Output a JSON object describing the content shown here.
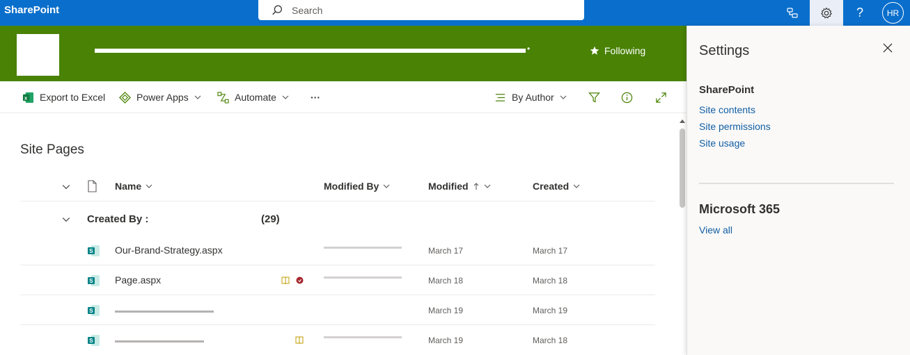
{
  "suite": {
    "brand": "SharePoint",
    "search_placeholder": "Search",
    "avatar_initials": "HR"
  },
  "site": {
    "follow_label": "Following"
  },
  "commandbar": {
    "export_label": "Export to Excel",
    "powerapps_label": "Power Apps",
    "automate_label": "Automate",
    "more_label": "···",
    "view_label": "By Author"
  },
  "list": {
    "title": "Site Pages",
    "columns": {
      "name": "Name",
      "modified_by": "Modified By",
      "modified": "Modified",
      "created": "Created"
    },
    "group": {
      "label": "Created By :",
      "count": "(29)"
    },
    "rows": [
      {
        "name": "Our-Brand-Strategy.aspx",
        "modified": "March 17",
        "created": "March 17"
      },
      {
        "name": "Page.aspx",
        "modified": "March 18",
        "created": "March 18"
      },
      {
        "name": "",
        "modified": "March 19",
        "created": "March 19"
      },
      {
        "name": "",
        "modified": "March 19",
        "created": "March 18"
      }
    ]
  },
  "settings": {
    "title": "Settings",
    "sharepoint_heading": "SharePoint",
    "links": [
      "Site contents",
      "Site permissions",
      "Site usage"
    ],
    "m365_heading": "Microsoft 365",
    "view_all": "View all"
  },
  "colors": {
    "suite_bar": "#0a6fcc",
    "site_header": "#498205",
    "link": "#115ea3"
  }
}
